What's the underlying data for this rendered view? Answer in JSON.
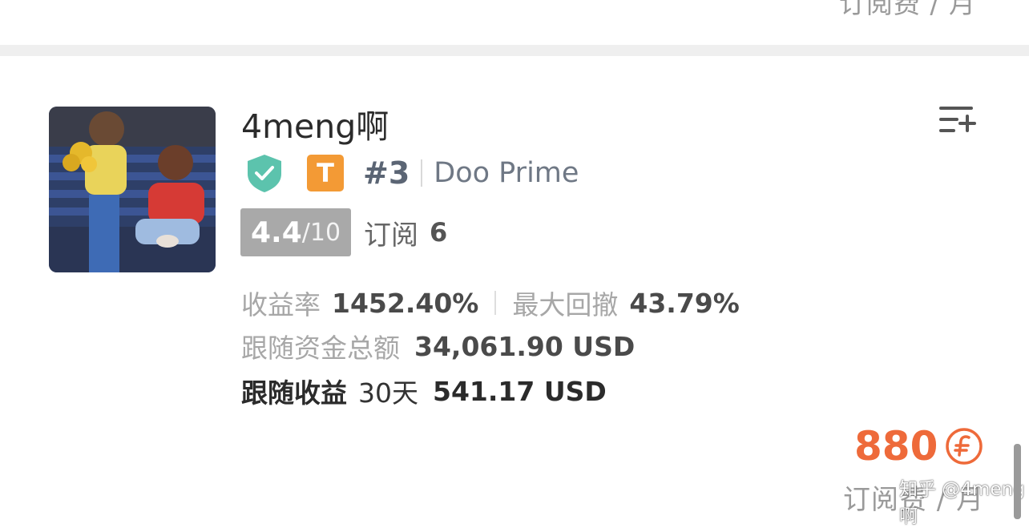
{
  "prev_card": {
    "price_unit": "订阅费 / 月"
  },
  "trader": {
    "name": "4meng啊",
    "tier_badge": "T",
    "rank": "#3",
    "broker": "Doo Prime",
    "rating": {
      "score": "4.4",
      "max": "/10"
    },
    "subscriptions": {
      "label": "订阅",
      "count": "6"
    }
  },
  "stats": {
    "return_rate": {
      "label": "收益率",
      "value": "1452.40%"
    },
    "max_drawdown": {
      "label": "最大回撤",
      "value": "43.79%"
    },
    "follow_funds": {
      "label": "跟随资金总额",
      "value": "34,061.90 USD"
    },
    "follow_profit": {
      "label": "跟随收益",
      "period": "30天",
      "value": "541.17 USD"
    }
  },
  "price": {
    "amount": "880",
    "unit": "订阅费 / 月"
  },
  "watermark": "知乎 @4meng啊",
  "colors": {
    "accent_orange": "#ee6a3a",
    "verified_green": "#5cc3ad",
    "tier_orange": "#f39a35",
    "rating_gray": "#a9a9a9"
  },
  "icons": {
    "verified": "shield-check-icon",
    "add_list": "playlist-add-icon",
    "coin": "coin-currency-icon"
  }
}
